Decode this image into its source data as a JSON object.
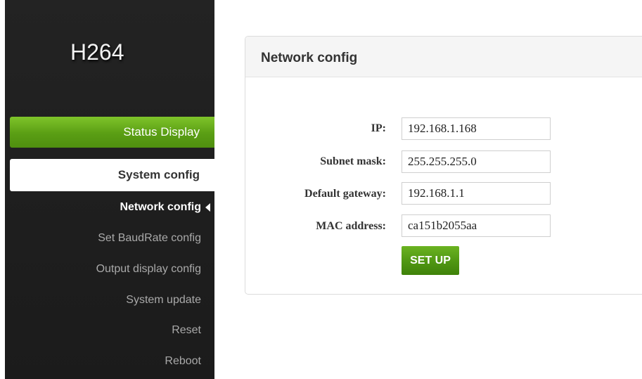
{
  "app": {
    "logo_text": "H264"
  },
  "sidebar": {
    "status_display_label": "Status Display",
    "system_config_label": "System config",
    "items": [
      {
        "label": "Network config",
        "active": true
      },
      {
        "label": "Set BaudRate config",
        "active": false
      },
      {
        "label": "Output display config",
        "active": false
      },
      {
        "label": "System update",
        "active": false
      },
      {
        "label": "Reset",
        "active": false
      },
      {
        "label": "Reboot",
        "active": false
      }
    ]
  },
  "panel": {
    "title": "Network config",
    "fields": [
      {
        "label": "IP:",
        "value": "192.168.1.168"
      },
      {
        "label": "Subnet mask:",
        "value": "255.255.255.0"
      },
      {
        "label": "Default gateway:",
        "value": "192.168.1.1"
      },
      {
        "label": "MAC address:",
        "value": "ca151b2055aa"
      }
    ],
    "submit_label": "SET UP"
  },
  "colors": {
    "accent_green": "#5a9e14",
    "sidebar_bg": "#1e1e1e"
  }
}
